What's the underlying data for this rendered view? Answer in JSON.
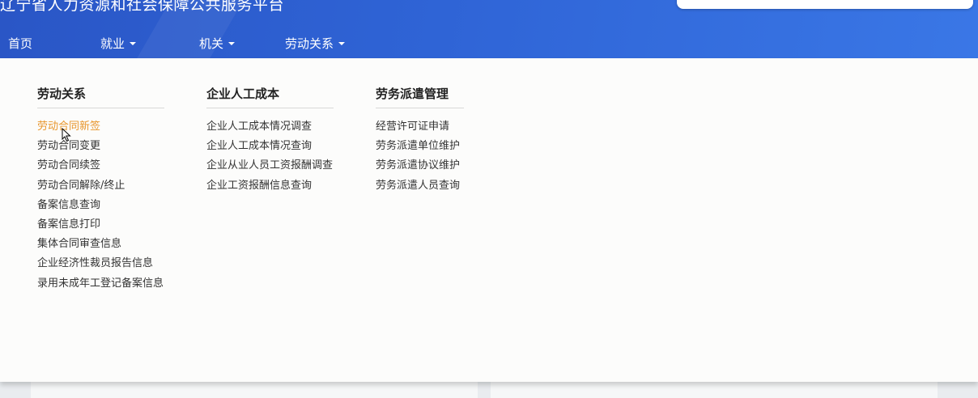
{
  "header": {
    "site_title": "辽宁省人力资源和社会保障公共服务平台"
  },
  "nav": {
    "items": [
      {
        "label": "首页"
      },
      {
        "label": "就业"
      },
      {
        "label": "机关"
      },
      {
        "label": "劳动关系"
      }
    ]
  },
  "dropdown": {
    "columns": [
      {
        "title": "劳动关系",
        "items": [
          {
            "label": "劳动合同新签"
          },
          {
            "label": "劳动合同变更"
          },
          {
            "label": "劳动合同续签"
          },
          {
            "label": "劳动合同解除/终止"
          },
          {
            "label": "备案信息查询"
          },
          {
            "label": "备案信息打印"
          },
          {
            "label": "集体合同审查信息"
          },
          {
            "label": "企业经济性裁员报告信息"
          },
          {
            "label": "录用未成年工登记备案信息"
          }
        ]
      },
      {
        "title": "企业人工成本",
        "items": [
          {
            "label": "企业人工成本情况调查"
          },
          {
            "label": "企业人工成本情况查询"
          },
          {
            "label": "企业从业人员工资报酬调查"
          },
          {
            "label": "企业工资报酬信息查询"
          }
        ]
      },
      {
        "title": "劳务派遣管理",
        "items": [
          {
            "label": "经营许可证申请"
          },
          {
            "label": "劳务派遣单位维护"
          },
          {
            "label": "劳务派遣协议维护"
          },
          {
            "label": "劳务派遣人员查询"
          }
        ]
      }
    ]
  },
  "colors": {
    "header_blue": "#2f64d6",
    "active_link": "#e8962d"
  }
}
